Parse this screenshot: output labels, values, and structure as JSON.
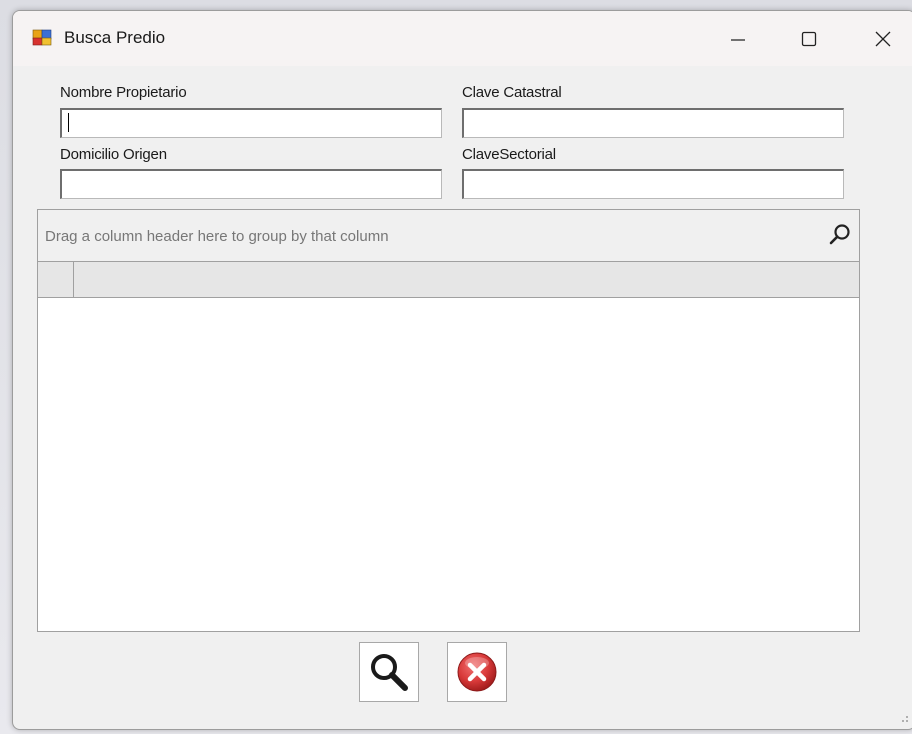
{
  "window": {
    "title": "Busca Predio"
  },
  "form": {
    "nombre_propietario": {
      "label": "Nombre Propietario",
      "value": ""
    },
    "clave_catastral": {
      "label": "Clave Catastral",
      "value": ""
    },
    "domicilio_origen": {
      "label": "Domicilio Origen",
      "value": ""
    },
    "clave_sectorial": {
      "label": "ClaveSectorial",
      "value": ""
    }
  },
  "grid": {
    "group_panel_text": "Drag a column header here to group by that column",
    "columns": [],
    "rows": []
  },
  "actions": {
    "search_icon": "magnifier-icon",
    "cancel_icon": "red-x-circle-icon"
  },
  "colors": {
    "window_bg": "#f0f0f0",
    "titlebar_bg": "#f6f3f3",
    "group_text": "#777777",
    "cancel_red": "#d93a3a"
  }
}
